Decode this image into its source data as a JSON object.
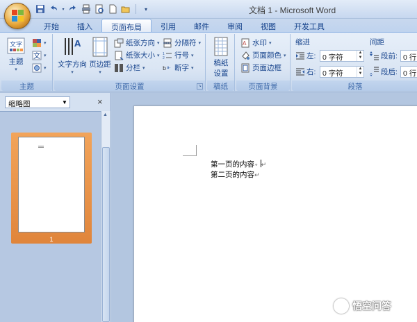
{
  "window": {
    "title": "文档 1 - Microsoft Word"
  },
  "tabs": [
    {
      "label": "开始",
      "active": false
    },
    {
      "label": "插入",
      "active": false
    },
    {
      "label": "页面布局",
      "active": true
    },
    {
      "label": "引用",
      "active": false
    },
    {
      "label": "邮件",
      "active": false
    },
    {
      "label": "审阅",
      "active": false
    },
    {
      "label": "视图",
      "active": false
    },
    {
      "label": "开发工具",
      "active": false
    }
  ],
  "ribbon": {
    "theme_group": {
      "label": "主题",
      "theme_button": "主题"
    },
    "page_setup_group": {
      "label": "页面设置",
      "text_direction": "文字方向",
      "margins": "页边距",
      "orientation": "纸张方向",
      "size": "纸张大小",
      "columns": "分栏",
      "breaks": "分隔符",
      "line_numbers": "行号",
      "hyphenation": "断字"
    },
    "draft_group": {
      "label": "稿纸",
      "draft_settings": "稿纸\n设置",
      "draft_line1": "稿纸",
      "draft_line2": "设置"
    },
    "page_background_group": {
      "label": "页面背景",
      "watermark": "水印",
      "page_color": "页面颜色",
      "page_borders": "页面边框"
    },
    "paragraph_group": {
      "label": "段落",
      "indent_title": "缩进",
      "spacing_title": "间距",
      "indent_left_label": "左:",
      "indent_left_value": "0 字符",
      "indent_right_label": "右:",
      "indent_right_value": "0 字符",
      "spacing_before_label": "段前:",
      "spacing_before_value": "0 行",
      "spacing_after_label": "段后:",
      "spacing_after_value": "0 行"
    }
  },
  "nav_pane": {
    "view_select": "缩略图",
    "page_number": "1"
  },
  "document": {
    "lines": [
      "第一页的内容",
      "第二页的内容"
    ]
  },
  "watermark_overlay": {
    "text": "悟空问答"
  },
  "colors": {
    "active_thumb": "#e0853b",
    "ribbon_text": "#15428b"
  }
}
